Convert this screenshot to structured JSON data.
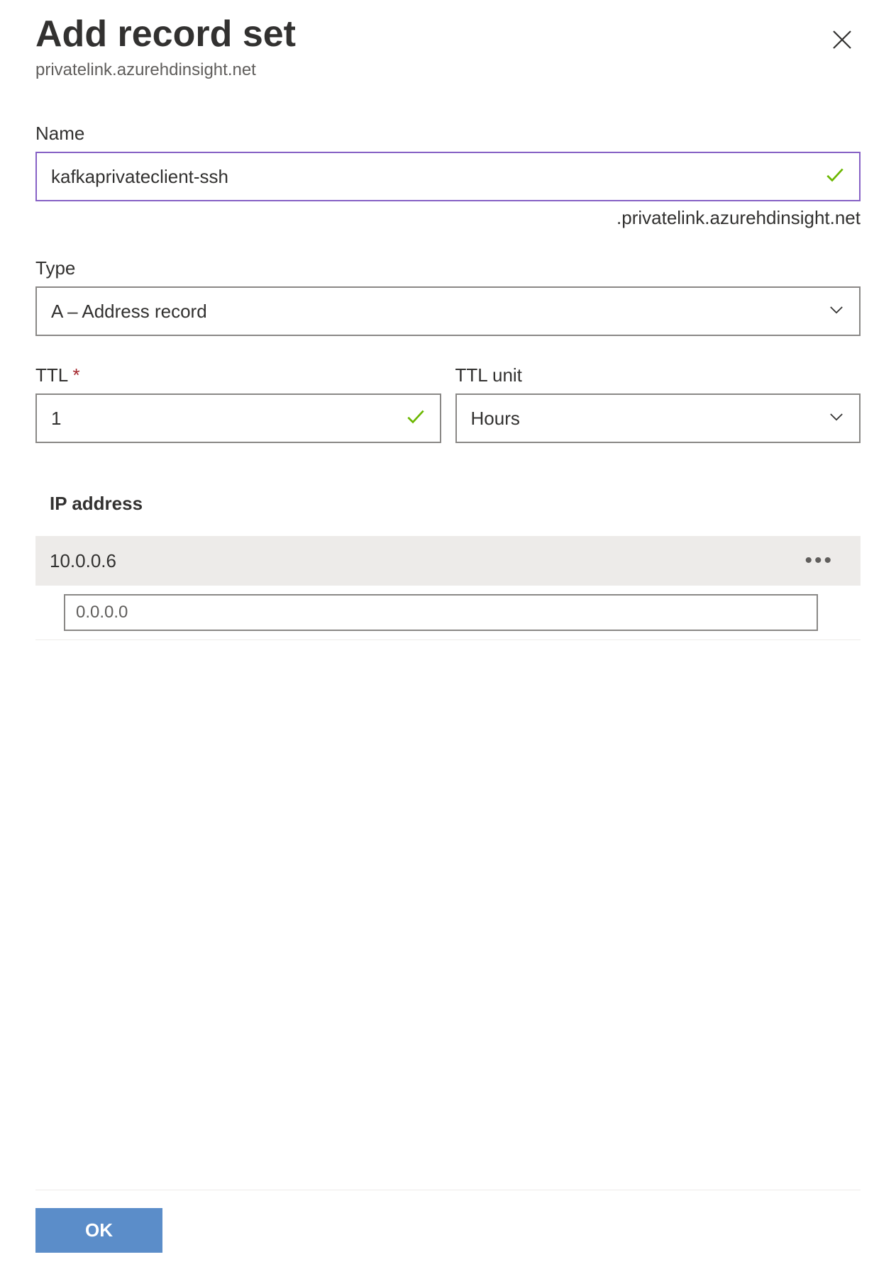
{
  "header": {
    "title": "Add record set",
    "subtitle": "privatelink.azurehdinsight.net"
  },
  "fields": {
    "name": {
      "label": "Name",
      "value": "kafkaprivateclient-ssh",
      "suffix": ".privatelink.azurehdinsight.net"
    },
    "type": {
      "label": "Type",
      "value": "A – Address record"
    },
    "ttl": {
      "label": "TTL",
      "value": "1"
    },
    "ttl_unit": {
      "label": "TTL unit",
      "value": "Hours"
    }
  },
  "ip_section": {
    "heading": "IP address",
    "addresses": [
      "10.0.0.6"
    ],
    "new_placeholder": "0.0.0.0"
  },
  "footer": {
    "ok_label": "OK"
  }
}
